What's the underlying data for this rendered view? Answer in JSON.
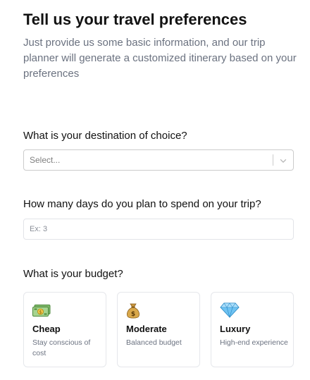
{
  "header": {
    "title": "Tell us your travel preferences",
    "subtitle": "Just provide us some basic information, and our trip planner will generate a customized itinerary based on your preferences"
  },
  "destination": {
    "label": "What is your destination of choice?",
    "placeholder": "Select...",
    "icon": "chevron-down-icon"
  },
  "days": {
    "label": "How many days do you plan to spend on your trip?",
    "placeholder": "Ex: 3",
    "value": ""
  },
  "budget": {
    "label": "What is your budget?",
    "options": [
      {
        "title": "Cheap",
        "desc": "Stay conscious of cost",
        "icon": "money-icon"
      },
      {
        "title": "Moderate",
        "desc": "Balanced budget",
        "icon": "money-bag-icon"
      },
      {
        "title": "Luxury",
        "desc": "High-end experience",
        "icon": "gem-icon"
      }
    ]
  },
  "colors": {
    "heading": "#121212",
    "muted": "#6b7280",
    "border": "#e5e7eb",
    "select_border": "#cccccc"
  }
}
